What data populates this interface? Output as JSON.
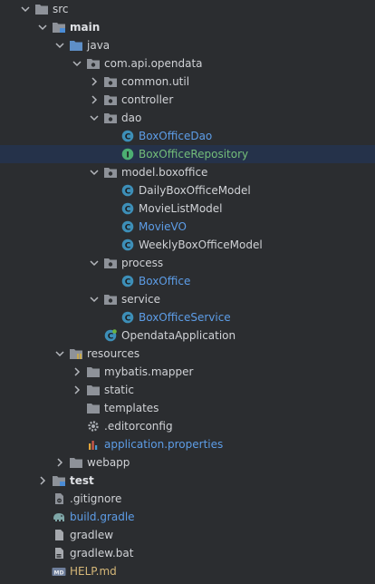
{
  "colors": {
    "background": "#2b2d30",
    "folder": "#8e9299",
    "source_folder": "#5e8fc7",
    "class_icon": "#3d8fb8",
    "interface_icon": "#4caf72",
    "blue_text": "#5d9de7",
    "green_text": "#73bd79",
    "yellow_text": "#d5b778"
  },
  "tree": [
    {
      "label": "src",
      "depth": 0,
      "chevron": "down",
      "icon": "folder-icon",
      "style": "white"
    },
    {
      "label": "main",
      "depth": 1,
      "chevron": "down",
      "icon": "module-folder-icon",
      "style": "bold"
    },
    {
      "label": "java",
      "depth": 2,
      "chevron": "down",
      "icon": "source-folder-icon",
      "style": "white"
    },
    {
      "label": "com.api.opendata",
      "depth": 3,
      "chevron": "down",
      "icon": "package-icon",
      "style": "white"
    },
    {
      "label": "common.util",
      "depth": 4,
      "chevron": "right",
      "icon": "package-icon",
      "style": "white"
    },
    {
      "label": "controller",
      "depth": 4,
      "chevron": "right",
      "icon": "package-icon",
      "style": "white"
    },
    {
      "label": "dao",
      "depth": 4,
      "chevron": "down",
      "icon": "package-icon",
      "style": "white"
    },
    {
      "label": "BoxOfficeDao",
      "depth": 5,
      "chevron": "none",
      "icon": "class-icon",
      "style": "blue"
    },
    {
      "label": "BoxOfficeRepository",
      "depth": 5,
      "chevron": "none",
      "icon": "interface-icon",
      "style": "green",
      "selected": true
    },
    {
      "label": "model.boxoffice",
      "depth": 4,
      "chevron": "down",
      "icon": "package-icon",
      "style": "white"
    },
    {
      "label": "DailyBoxOfficeModel",
      "depth": 5,
      "chevron": "none",
      "icon": "class-icon",
      "style": "white"
    },
    {
      "label": "MovieListModel",
      "depth": 5,
      "chevron": "none",
      "icon": "class-icon",
      "style": "white"
    },
    {
      "label": "MovieVO",
      "depth": 5,
      "chevron": "none",
      "icon": "class-icon",
      "style": "blue"
    },
    {
      "label": "WeeklyBoxOfficeModel",
      "depth": 5,
      "chevron": "none",
      "icon": "class-icon",
      "style": "white"
    },
    {
      "label": "process",
      "depth": 4,
      "chevron": "down",
      "icon": "package-icon",
      "style": "white"
    },
    {
      "label": "BoxOffice",
      "depth": 5,
      "chevron": "none",
      "icon": "class-icon",
      "style": "blue"
    },
    {
      "label": "service",
      "depth": 4,
      "chevron": "down",
      "icon": "package-icon",
      "style": "white"
    },
    {
      "label": "BoxOfficeService",
      "depth": 5,
      "chevron": "none",
      "icon": "class-icon",
      "style": "blue"
    },
    {
      "label": "OpendataApplication",
      "depth": 4,
      "chevron": "none",
      "icon": "spring-class-icon",
      "style": "white"
    },
    {
      "label": "resources",
      "depth": 2,
      "chevron": "down",
      "icon": "resources-folder-icon",
      "style": "white"
    },
    {
      "label": "mybatis.mapper",
      "depth": 3,
      "chevron": "right",
      "icon": "folder-icon",
      "style": "white"
    },
    {
      "label": "static",
      "depth": 3,
      "chevron": "right",
      "icon": "folder-icon",
      "style": "white"
    },
    {
      "label": "templates",
      "depth": 3,
      "chevron": "none",
      "icon": "folder-icon",
      "style": "white"
    },
    {
      "label": ".editorconfig",
      "depth": 3,
      "chevron": "none",
      "icon": "gear-icon",
      "style": "white"
    },
    {
      "label": "application.properties",
      "depth": 3,
      "chevron": "none",
      "icon": "properties-icon",
      "style": "blue"
    },
    {
      "label": "webapp",
      "depth": 2,
      "chevron": "right",
      "icon": "folder-icon",
      "style": "white"
    },
    {
      "label": "test",
      "depth": 1,
      "chevron": "right",
      "icon": "module-folder-icon",
      "style": "bold"
    },
    {
      "label": ".gitignore",
      "depth": 1,
      "chevron": "none",
      "icon": "gitignore-icon",
      "style": "white"
    },
    {
      "label": "build.gradle",
      "depth": 1,
      "chevron": "none",
      "icon": "gradle-elephant-icon",
      "style": "blue"
    },
    {
      "label": "gradlew",
      "depth": 1,
      "chevron": "none",
      "icon": "file-icon",
      "style": "white"
    },
    {
      "label": "gradlew.bat",
      "depth": 1,
      "chevron": "none",
      "icon": "bat-file-icon",
      "style": "white"
    },
    {
      "label": "HELP.md",
      "depth": 1,
      "chevron": "none",
      "icon": "markdown-icon",
      "style": "yellow"
    }
  ]
}
